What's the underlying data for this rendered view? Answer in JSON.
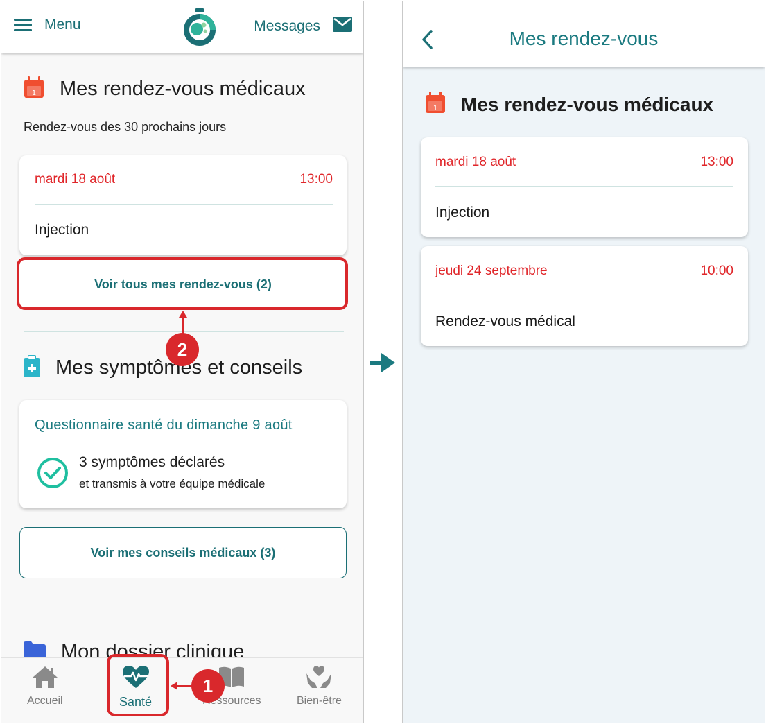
{
  "left": {
    "header": {
      "menu_label": "Menu",
      "messages_label": "Messages"
    },
    "appointments": {
      "title": "Mes rendez-vous médicaux",
      "subtitle": "Rendez-vous des 30 prochains jours",
      "card": {
        "date": "mardi 18 août",
        "time": "13:00",
        "event": "Injection"
      },
      "view_all_label": "Voir tous mes rendez-vous (2)"
    },
    "symptoms": {
      "title": "Mes symptômes et conseils",
      "questionnaire_title": "Questionnaire santé du dimanche 9 août",
      "line1": "3 symptômes déclarés",
      "line2": "et transmis à votre équipe médicale",
      "advice_label": "Voir mes conseils médicaux (3)"
    },
    "clinical": {
      "title": "Mon dossier clinique"
    },
    "bottom_nav": [
      {
        "label": "Accueil",
        "icon": "home-icon"
      },
      {
        "label": "Santé",
        "icon": "heart-pulse-icon"
      },
      {
        "label": "Ressources",
        "icon": "book-icon"
      },
      {
        "label": "Bien-être",
        "icon": "hands-heart-icon"
      }
    ],
    "annotations": {
      "step1": "1",
      "step2": "2"
    }
  },
  "right": {
    "header": {
      "title": "Mes rendez-vous"
    },
    "section_title": "Mes rendez-vous médicaux",
    "appointments": [
      {
        "date": "mardi 18 août",
        "time": "13:00",
        "event": "Injection"
      },
      {
        "date": "jeudi 24 septembre",
        "time": "10:00",
        "event": "Rendez-vous médical"
      }
    ]
  },
  "colors": {
    "accent": "#1b6f75",
    "date_red": "#e0262a",
    "annotation_red": "#d9282c",
    "calendar_icon": "#f04e30"
  }
}
